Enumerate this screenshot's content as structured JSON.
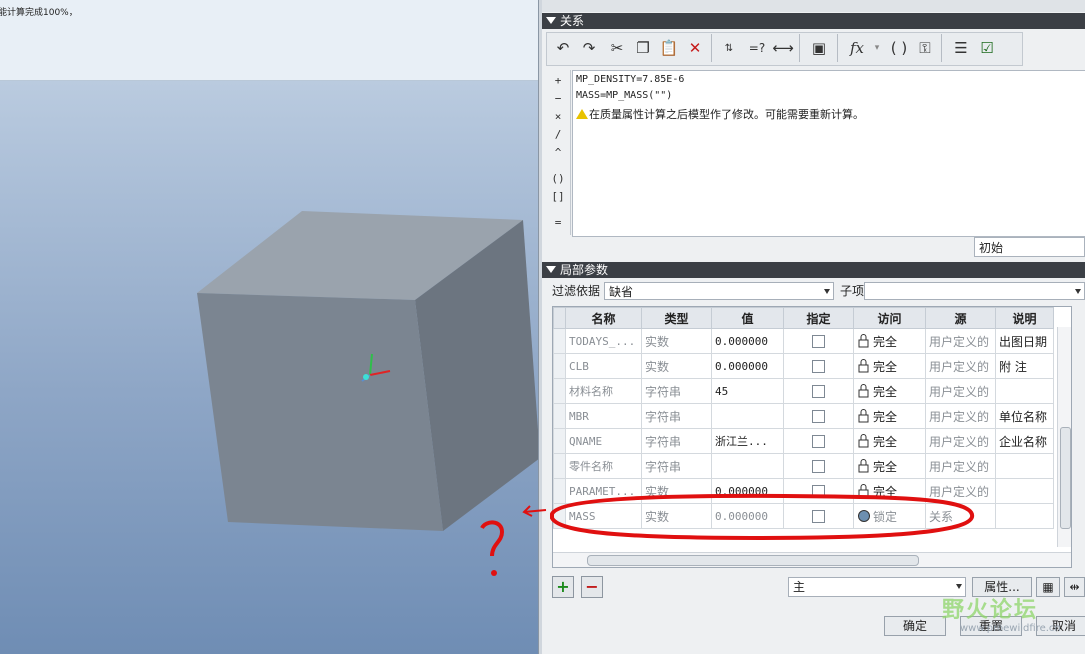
{
  "viewport": {
    "status_message": "能计算完成100%，"
  },
  "relations": {
    "header": "关系",
    "operators": [
      "+",
      "−",
      "×",
      "/",
      "^",
      "()",
      "[]",
      "="
    ],
    "editor_lines": [
      "MP_DENSITY=7.85E-6",
      "MASS=MP_MASS(\"\")"
    ],
    "warning_text": "在质量属性计算之后模型作了修改。可能需要重新计算。",
    "start_combo": "初始"
  },
  "local_params": {
    "header": "局部参数",
    "filter_label": "过滤依据",
    "filter_value": "缺省",
    "child_label": "子项",
    "child_value": "",
    "columns": [
      "名称",
      "类型",
      "值",
      "指定",
      "访问",
      "源",
      "说明"
    ],
    "rows": [
      {
        "name": "TODAYS_...",
        "type": "实数",
        "value": "0.000000",
        "access": "完全",
        "source": "用户定义的",
        "desc": "出图日期"
      },
      {
        "name": "CLB",
        "type": "实数",
        "value": "0.000000",
        "access": "完全",
        "source": "用户定义的",
        "desc": "附 注"
      },
      {
        "name": "材料名称",
        "type": "字符串",
        "value": "45",
        "access": "完全",
        "source": "用户定义的",
        "desc": ""
      },
      {
        "name": "MBR",
        "type": "字符串",
        "value": "",
        "access": "完全",
        "source": "用户定义的",
        "desc": "单位名称"
      },
      {
        "name": "QNAME",
        "type": "字符串",
        "value": "浙江兰...",
        "access": "完全",
        "source": "用户定义的",
        "desc": "企业名称"
      },
      {
        "name": "零件名称",
        "type": "字符串",
        "value": "",
        "access": "完全",
        "source": "用户定义的",
        "desc": ""
      },
      {
        "name": "PARAMET...",
        "type": "实数",
        "value": "0.000000",
        "access": "完全",
        "source": "用户定义的",
        "desc": ""
      },
      {
        "name": "MASS",
        "type": "实数",
        "value": "0.000000",
        "access": "锁定",
        "source": "关系",
        "desc": ""
      }
    ],
    "scope_combo": "主",
    "properties_button": "属性..."
  },
  "footer": {
    "ok": "确定",
    "reset": "重置",
    "cancel": "取消"
  },
  "watermark": {
    "text": "野火论坛",
    "url": "www.proewildfire.cn"
  },
  "colors": {
    "header_bg": "#3b3f45",
    "annotation": "#e01010",
    "cube_front": "#7b8591"
  }
}
